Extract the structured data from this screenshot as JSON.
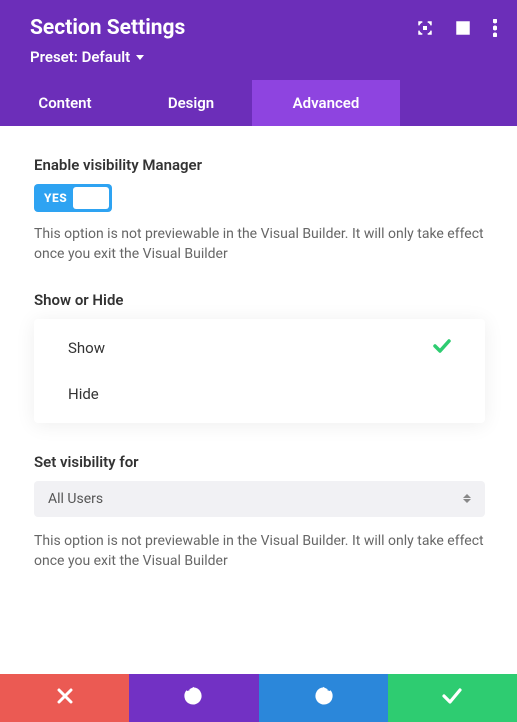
{
  "header": {
    "title": "Section Settings",
    "preset_label": "Preset: Default"
  },
  "tabs": {
    "content": "Content",
    "design": "Design",
    "advanced": "Advanced"
  },
  "fields": {
    "enable_visibility": {
      "label": "Enable visibility Manager",
      "toggle_value": "YES",
      "help": "This option is not previewable in the Visual Builder. It will only take effect once you exit the Visual Builder"
    },
    "show_hide": {
      "label": "Show or Hide",
      "options": {
        "show": "Show",
        "hide": "Hide"
      }
    },
    "set_visibility": {
      "label": "Set visibility for",
      "selected": "All Users",
      "help": "This option is not previewable in the Visual Builder. It will only take effect once you exit the Visual Builder"
    }
  }
}
